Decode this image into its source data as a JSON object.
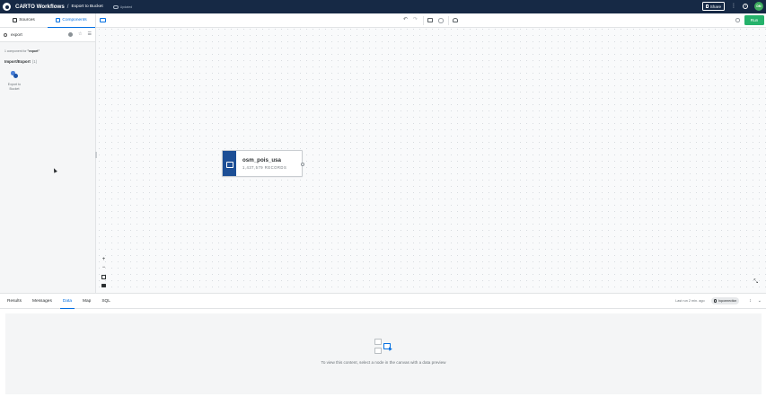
{
  "topbar": {
    "app_title": "CARTO Workflows",
    "separator": "/",
    "workflow_name": "Export to Bucket",
    "save_status": "Updated",
    "share_label": "Share",
    "user_initials": "DM"
  },
  "left_panel": {
    "tabs": [
      {
        "label": "Sources",
        "active": false
      },
      {
        "label": "Components",
        "active": true
      }
    ],
    "search_value": "export",
    "result_count_prefix": "1 component for",
    "result_count_query": "\"export\"",
    "group": {
      "name": "Import/Export",
      "count": "(1)"
    },
    "components": [
      {
        "label": "Export to Bucket",
        "icon": "export-to-bucket-icon"
      }
    ]
  },
  "toolbar": {
    "run_label": "Run"
  },
  "canvas": {
    "node": {
      "title": "osm_pois_usa",
      "subtitle": "1,437,579 RECORDS",
      "icon": "table-icon"
    },
    "zoom_in": "+",
    "zoom_out": "−"
  },
  "bottom_panel": {
    "tabs": [
      {
        "label": "Results",
        "active": false
      },
      {
        "label": "Messages",
        "active": false
      },
      {
        "label": "Data",
        "active": true
      },
      {
        "label": "Map",
        "active": false
      },
      {
        "label": "SQL",
        "active": false
      }
    ],
    "last_run": "Last run 2 min. ago",
    "connection": "bqconnection",
    "empty_message": "To view this content, select a node in the canvas with a data preview"
  },
  "colors": {
    "topbar": "#162945",
    "accent": "#036fe2",
    "run": "#25b26b",
    "node_icon": "#1d4f96",
    "avatar": "#3eab5e"
  }
}
